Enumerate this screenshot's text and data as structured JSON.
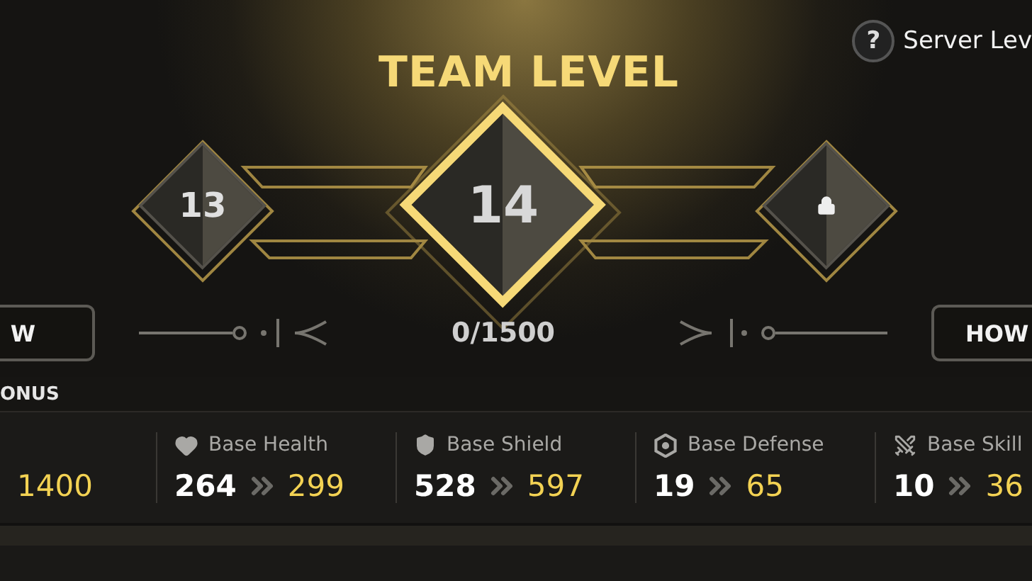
{
  "title": "TEAM LEVEL",
  "help": {
    "symbol": "?",
    "label": "Server Lev"
  },
  "levels": [
    {
      "kind": "past",
      "value": "13"
    },
    {
      "kind": "current",
      "value": "14"
    },
    {
      "kind": "locked"
    }
  ],
  "progress": "0/1500",
  "buttons": [
    {
      "label": "W"
    },
    {
      "label": "HOW"
    }
  ],
  "bonus": {
    "title": "ONUS",
    "stats": [
      {
        "kind": "partial",
        "to": "1400"
      },
      {
        "kind": "health",
        "label": "Base Health",
        "from": "264",
        "to": "299"
      },
      {
        "kind": "shield",
        "label": "Base Shield",
        "from": "528",
        "to": "597"
      },
      {
        "kind": "defense",
        "label": "Base Defense",
        "from": "19",
        "to": "65"
      },
      {
        "kind": "skill",
        "label": "Base Skill",
        "from": "10",
        "to": "36"
      }
    ]
  }
}
